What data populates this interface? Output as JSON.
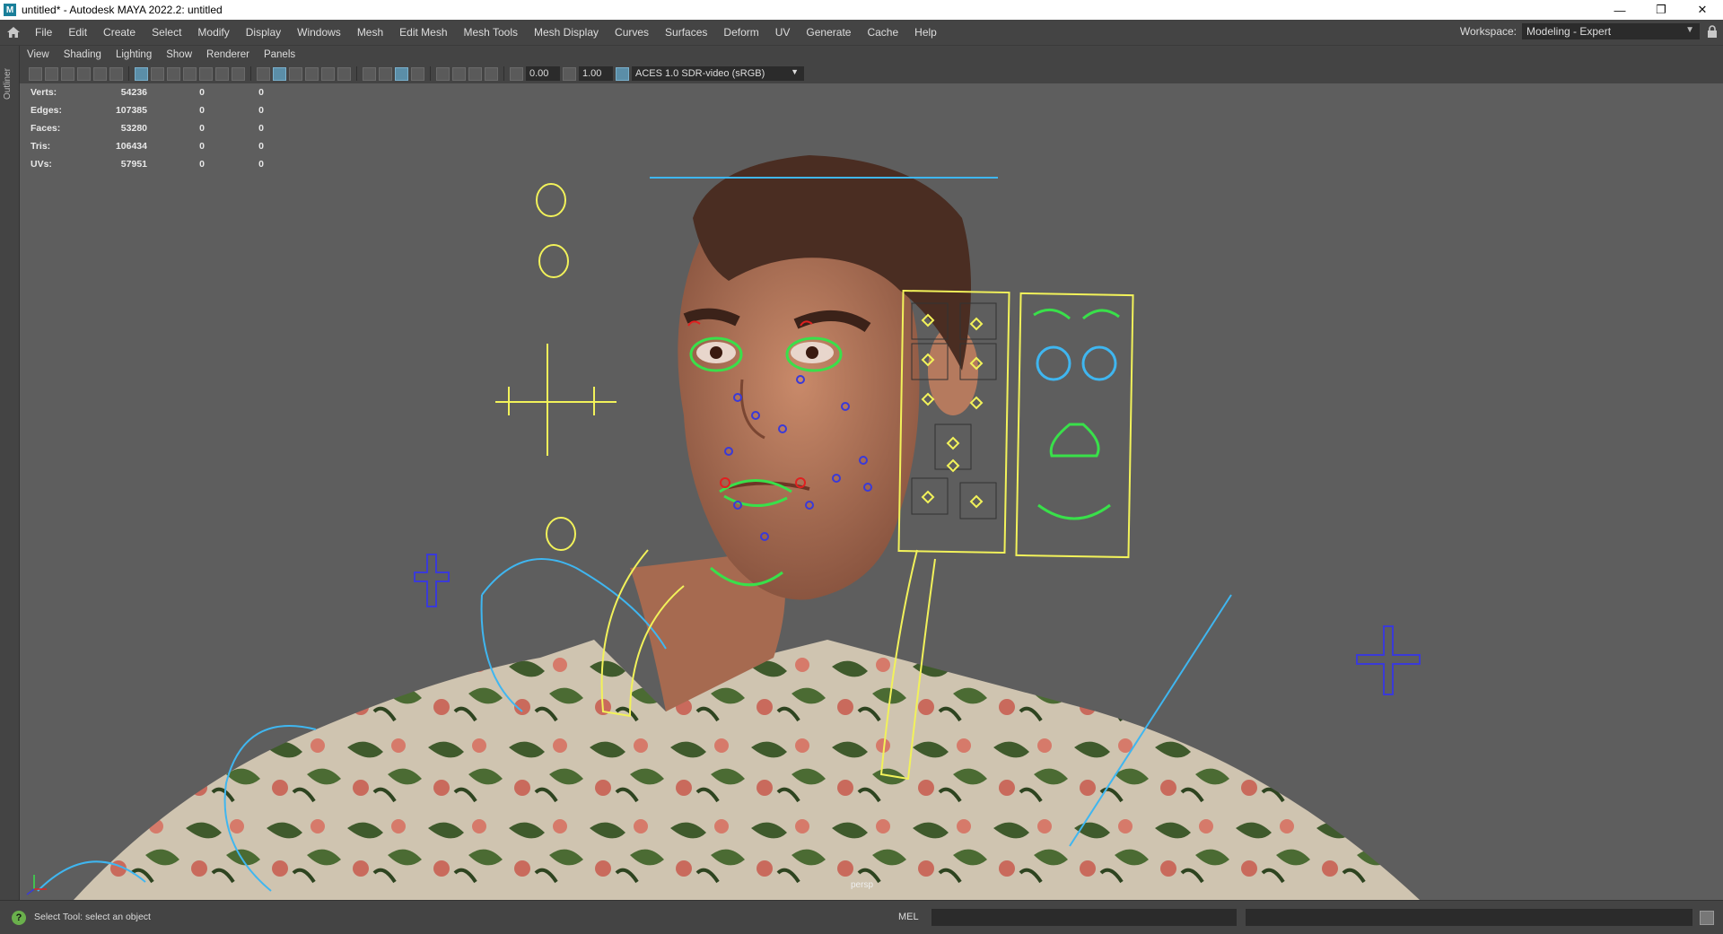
{
  "window": {
    "title": "untitled* - Autodesk MAYA 2022.2: untitled",
    "app_icon": "M",
    "controls": [
      "minimize-icon",
      "restore-icon",
      "close-icon"
    ],
    "control_glyphs": [
      "—",
      "❐",
      "✕"
    ]
  },
  "menubar": {
    "items": [
      "File",
      "Edit",
      "Create",
      "Select",
      "Modify",
      "Display",
      "Windows",
      "Mesh",
      "Edit Mesh",
      "Mesh Tools",
      "Mesh Display",
      "Curves",
      "Surfaces",
      "Deform",
      "UV",
      "Generate",
      "Cache",
      "Help"
    ],
    "workspace_label": "Workspace:",
    "workspace_value": "Modeling - Expert"
  },
  "outliner_strip": {
    "label": "Outliner"
  },
  "panel_menu": {
    "items": [
      "View",
      "Shading",
      "Lighting",
      "Show",
      "Renderer",
      "Panels"
    ]
  },
  "toolbar": {
    "exposure": "0.00",
    "gamma": "1.00",
    "color_space": "ACES 1.0 SDR-video (sRGB)"
  },
  "hud": {
    "rows": [
      {
        "label": "Verts:",
        "v1": "54236",
        "v2": "0",
        "v3": "0"
      },
      {
        "label": "Edges:",
        "v1": "107385",
        "v2": "0",
        "v3": "0"
      },
      {
        "label": "Faces:",
        "v1": "53280",
        "v2": "0",
        "v3": "0"
      },
      {
        "label": "Tris:",
        "v1": "106434",
        "v2": "0",
        "v3": "0"
      },
      {
        "label": "UVs:",
        "v1": "57951",
        "v2": "0",
        "v3": "0"
      }
    ]
  },
  "viewport": {
    "camera": "persp"
  },
  "statusbar": {
    "help_text": "Select Tool: select an object",
    "command_language": "MEL"
  },
  "colors": {
    "ui_bg": "#444444",
    "viewport_bg": "#5e5e5e",
    "rig_yellow": "#f2f25a",
    "rig_green": "#39e04a",
    "rig_cyan": "#3fb6f0",
    "rig_blue": "#3a3ad8",
    "rig_red": "#e02020"
  }
}
